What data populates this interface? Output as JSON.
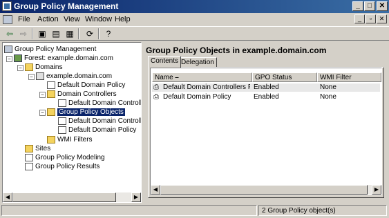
{
  "window": {
    "title": "Group Policy Management"
  },
  "menu": {
    "items": [
      {
        "label": "File"
      },
      {
        "label": "Action"
      },
      {
        "label": "View"
      },
      {
        "label": "Window"
      },
      {
        "label": "Help"
      }
    ]
  },
  "toolbar": {
    "buttons": [
      "back-icon",
      "forward-icon",
      "up-folder-icon",
      "show-hide-tree-icon",
      "properties-icon",
      "refresh-icon",
      "help-icon"
    ]
  },
  "tree": {
    "root": "Group Policy Management",
    "forest": "Forest: example.domain.com",
    "domains": "Domains",
    "domain": "example.domain.com",
    "default_domain_policy": "Default Domain Policy",
    "domain_controllers": "Domain Controllers",
    "default_domain_controller": "Default Domain Controller",
    "group_policy_objects": "Group Policy Objects",
    "gpo_default_domain_controller": "Default Domain Controller",
    "gpo_default_domain_policy": "Default Domain Policy",
    "wmi_filters": "WMI Filters",
    "sites": "Sites",
    "modeling": "Group Policy Modeling",
    "results": "Group Policy Results"
  },
  "main": {
    "title": "Group Policy Objects in example.domain.com",
    "tabs": [
      {
        "label": "Contents",
        "active": true
      },
      {
        "label": "Delegation",
        "active": false
      }
    ],
    "columns": [
      "Name",
      "GPO Status",
      "WMI Filter"
    ],
    "rows": [
      {
        "name": "Default Domain Controllers P...",
        "status": "Enabled",
        "wmi": "None"
      },
      {
        "name": "Default Domain Policy",
        "status": "Enabled",
        "wmi": "None"
      }
    ]
  },
  "status": {
    "text": "2 Group Policy object(s)"
  }
}
